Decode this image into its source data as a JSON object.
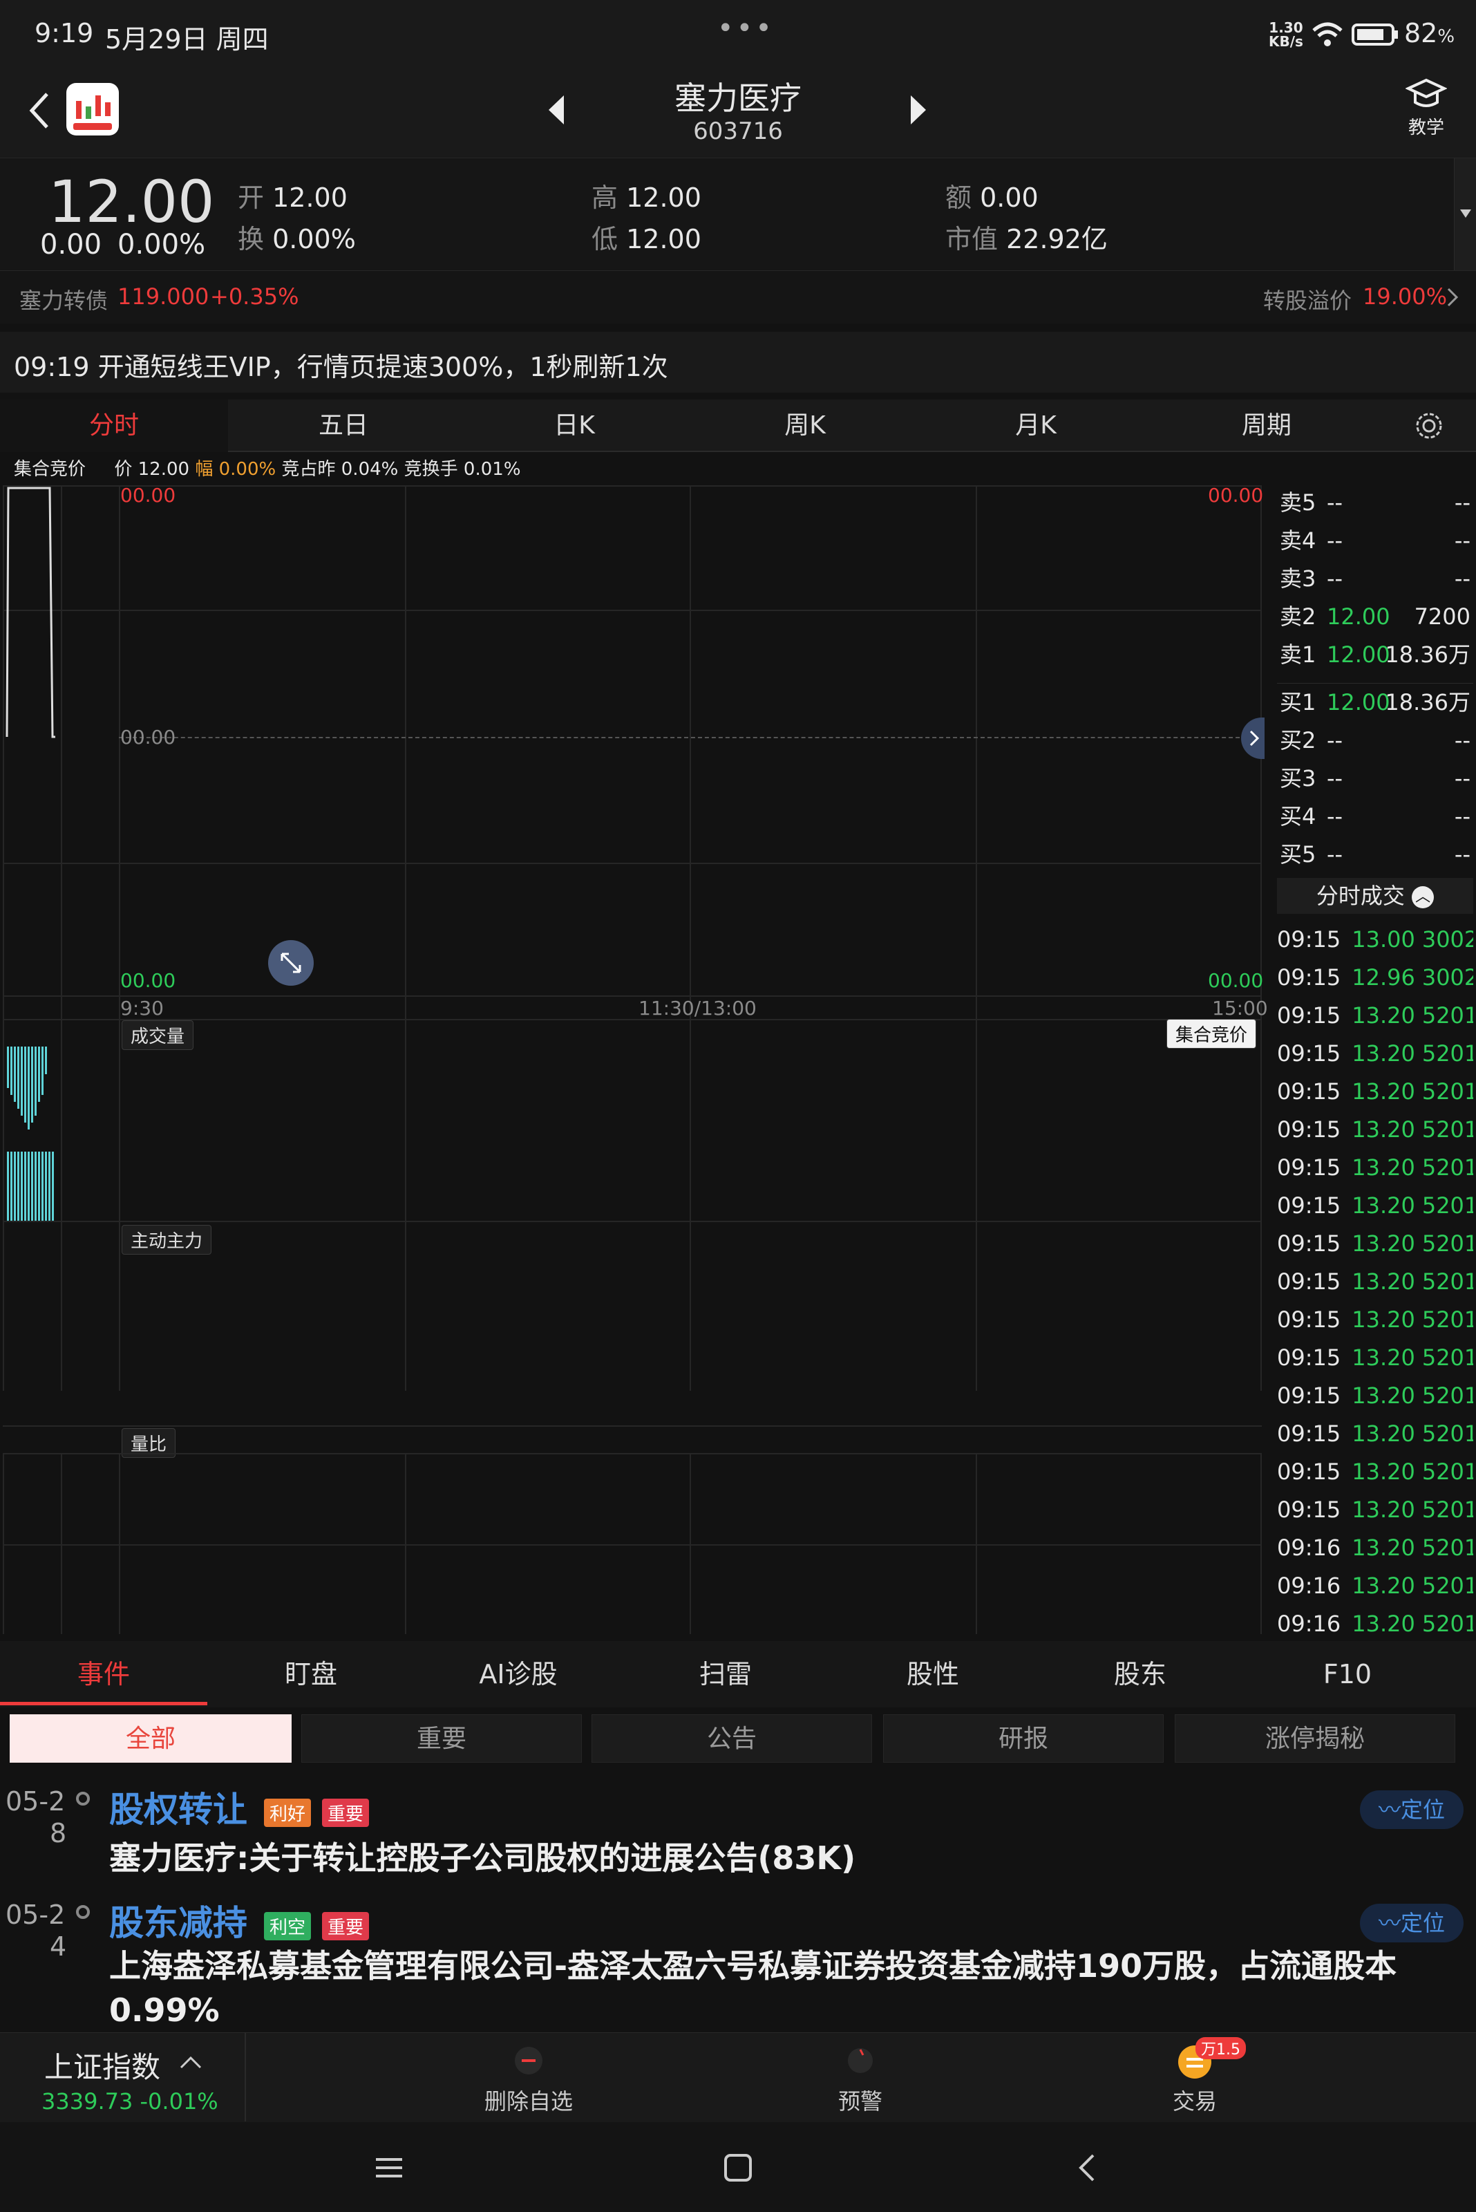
{
  "status": {
    "time": "9:19",
    "date": "5月29日 周四",
    "net_speed_value": "1.30",
    "net_speed_unit": "KB/s",
    "battery": "82",
    "battery_unit": "%"
  },
  "header": {
    "stock_name": "塞力医疗",
    "stock_code": "603716",
    "teach_label": "教学"
  },
  "quote": {
    "price": "12.00",
    "change": "0.00",
    "change_pct": "0.00%",
    "open_label": "开",
    "open": "12.00",
    "turnover_label": "换",
    "turnover": "0.00%",
    "high_label": "高",
    "high": "12.00",
    "low_label": "低",
    "low": "12.00",
    "amount_label": "额",
    "amount": "0.00",
    "mcap_label": "市值",
    "mcap": "22.92亿"
  },
  "bond": {
    "name": "塞力转债",
    "price": "119.000",
    "change": "+0.35%",
    "premium_label": "转股溢价",
    "premium": "19.00%"
  },
  "banner": {
    "text": "09:19 开通短线王VIP，行情页提速300%，1秒刷新1次"
  },
  "period_tabs": [
    "分时",
    "五日",
    "日K",
    "周K",
    "月K",
    "周期"
  ],
  "chart_info": {
    "auction_label": "集合竞价",
    "price_label": "价",
    "price": "12.00",
    "amp_label": "幅",
    "amp": "0.00%",
    "bid_label": "竞占昨",
    "bid": "0.04%",
    "hand_label": "竞换手",
    "hand": "0.01%"
  },
  "chart_data": {
    "type": "line",
    "y_top_left": "00.00",
    "y_top_right": "00.00",
    "y_mid": "00.00",
    "y_bottom_left": "00.00",
    "y_bottom_right": "00.00",
    "x_ticks": [
      "9:30",
      "11:30/13:00",
      "15:00"
    ],
    "volume_label": "成交量",
    "auction_tag": "集合竞价",
    "main_force_label": "主动主力",
    "volume_ratio_label": "量比"
  },
  "orderbook": {
    "sell": [
      {
        "label": "卖5",
        "price": "--",
        "vol": "--"
      },
      {
        "label": "卖4",
        "price": "--",
        "vol": "--"
      },
      {
        "label": "卖3",
        "price": "--",
        "vol": "--"
      },
      {
        "label": "卖2",
        "price": "12.00",
        "vol": "7200"
      },
      {
        "label": "卖1",
        "price": "12.00",
        "vol": "18.36万"
      }
    ],
    "buy": [
      {
        "label": "买1",
        "price": "12.00",
        "vol": "18.36万"
      },
      {
        "label": "买2",
        "price": "--",
        "vol": "--"
      },
      {
        "label": "买3",
        "price": "--",
        "vol": "--"
      },
      {
        "label": "买4",
        "price": "--",
        "vol": "--"
      },
      {
        "label": "买5",
        "price": "--",
        "vol": "--"
      }
    ],
    "ticks_label": "分时成交"
  },
  "ticks": [
    {
      "t": "09:15",
      "p": "13.00",
      "v": "3002"
    },
    {
      "t": "09:15",
      "p": "12.96",
      "v": "3002"
    },
    {
      "t": "09:15",
      "p": "13.20",
      "v": "5201"
    },
    {
      "t": "09:15",
      "p": "13.20",
      "v": "5201"
    },
    {
      "t": "09:15",
      "p": "13.20",
      "v": "5201"
    },
    {
      "t": "09:15",
      "p": "13.20",
      "v": "5201"
    },
    {
      "t": "09:15",
      "p": "13.20",
      "v": "5201"
    },
    {
      "t": "09:15",
      "p": "13.20",
      "v": "5201"
    },
    {
      "t": "09:15",
      "p": "13.20",
      "v": "5201"
    },
    {
      "t": "09:15",
      "p": "13.20",
      "v": "5201"
    },
    {
      "t": "09:15",
      "p": "13.20",
      "v": "5201"
    },
    {
      "t": "09:15",
      "p": "13.20",
      "v": "5201"
    },
    {
      "t": "09:15",
      "p": "13.20",
      "v": "5201"
    },
    {
      "t": "09:15",
      "p": "13.20",
      "v": "5201"
    },
    {
      "t": "09:15",
      "p": "13.20",
      "v": "5201"
    },
    {
      "t": "09:15",
      "p": "13.20",
      "v": "5201"
    },
    {
      "t": "09:16",
      "p": "13.20",
      "v": "5201"
    },
    {
      "t": "09:16",
      "p": "13.20",
      "v": "5201"
    },
    {
      "t": "09:16",
      "p": "13.20",
      "v": "5201"
    }
  ],
  "event_tabs": [
    "事件",
    "盯盘",
    "AI诊股",
    "扫雷",
    "股性",
    "股东",
    "F10"
  ],
  "filters": [
    "全部",
    "重要",
    "公告",
    "研报",
    "涨停揭秘"
  ],
  "news": [
    {
      "date_top": "05-2",
      "date_bottom": "8",
      "title": "股权转让",
      "tag1": "利好",
      "tag2": "重要",
      "locate": "定位",
      "body": "塞力医疗:关于转让控股子公司股权的进展公告(83K)"
    },
    {
      "date_top": "05-2",
      "date_bottom": "4",
      "title": "股东减持",
      "tag1": "利空",
      "tag2": "重要",
      "locate": "定位",
      "body": "上海盎泽私募基金管理有限公司-盎泽太盈六号私募证券投资基金减持190万股，占流通股本0.99%"
    }
  ],
  "index_bar": {
    "name": "上证指数",
    "value": "3339.73",
    "change": "-0.01%",
    "delete_label": "删除自选",
    "alert_label": "预警",
    "trade_label": "交易",
    "trade_badge": "万1.5"
  },
  "colors": {
    "up": "#ee3b3b",
    "down": "#2ecc5a",
    "accent": "#e84a3d",
    "link": "#4a90e2",
    "volume_bar": "#5fd3d8"
  }
}
